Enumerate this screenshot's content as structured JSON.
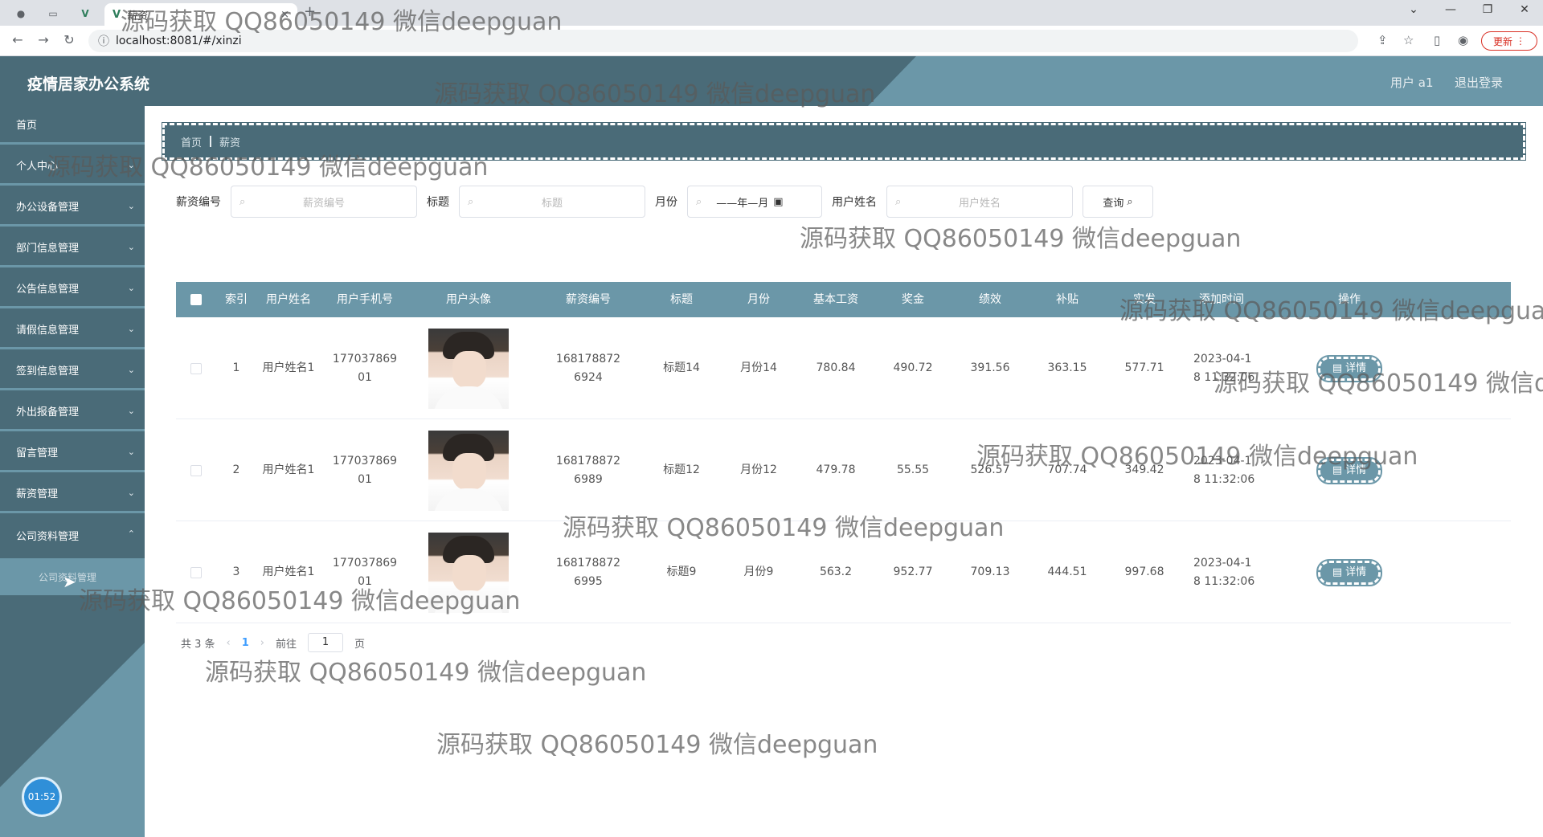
{
  "browser": {
    "tab_title": "薪资",
    "url": "localhost:8081/#/xinzi",
    "update_label": "更新"
  },
  "header": {
    "title": "疫情居家办公系统",
    "user": "用户 a1",
    "logout": "退出登录"
  },
  "sidebar": {
    "items": [
      {
        "label": "首页"
      },
      {
        "label": "个人中心"
      },
      {
        "label": "办公设备管理"
      },
      {
        "label": "部门信息管理"
      },
      {
        "label": "公告信息管理"
      },
      {
        "label": "请假信息管理"
      },
      {
        "label": "签到信息管理"
      },
      {
        "label": "外出报备管理"
      },
      {
        "label": "留言管理"
      },
      {
        "label": "薪资管理"
      },
      {
        "label": "公司资料管理"
      }
    ],
    "submenu_label": "公司资料管理",
    "clock": "01:52"
  },
  "breadcrumb": {
    "home": "首页",
    "current": "薪资"
  },
  "search": {
    "salary_no_label": "薪资编号",
    "salary_no_placeholder": "薪资编号",
    "title_label": "标题",
    "title_placeholder": "标题",
    "month_label": "月份",
    "month_value": "——年—月",
    "username_label": "用户姓名",
    "username_placeholder": "用户姓名",
    "query_label": "查询"
  },
  "table": {
    "headers": [
      "索引",
      "用户姓名",
      "用户手机号",
      "用户头像",
      "薪资编号",
      "标题",
      "月份",
      "基本工资",
      "奖金",
      "绩效",
      "补贴",
      "实发",
      "添加时间",
      "操作"
    ],
    "rows": [
      {
        "index": "1",
        "name": "用户姓名1",
        "phone_a": "177037869",
        "phone_b": "01",
        "salary_no_a": "168178872",
        "salary_no_b": "6924",
        "title": "标题14",
        "month": "月份14",
        "base": "780.84",
        "bonus": "490.72",
        "perf": "391.56",
        "allowance": "363.15",
        "net": "577.71",
        "time_a": "2023-04-1",
        "time_b": "8 11:32:06",
        "action": "详情"
      },
      {
        "index": "2",
        "name": "用户姓名1",
        "phone_a": "177037869",
        "phone_b": "01",
        "salary_no_a": "168178872",
        "salary_no_b": "6989",
        "title": "标题12",
        "month": "月份12",
        "base": "479.78",
        "bonus": "55.55",
        "perf": "526.57",
        "allowance": "707.74",
        "net": "349.42",
        "time_a": "2023-04-1",
        "time_b": "8 11:32:06",
        "action": "详情"
      },
      {
        "index": "3",
        "name": "用户姓名1",
        "phone_a": "177037869",
        "phone_b": "01",
        "salary_no_a": "168178872",
        "salary_no_b": "6995",
        "title": "标题9",
        "month": "月份9",
        "base": "563.2",
        "bonus": "952.77",
        "perf": "709.13",
        "allowance": "444.51",
        "net": "997.68",
        "time_a": "2023-04-1",
        "time_b": "8 11:32:06",
        "action": "详情"
      }
    ]
  },
  "pagination": {
    "total": "共 3 条",
    "current_page": "1",
    "goto_label": "前往",
    "goto_value": "1",
    "page_suffix": "页"
  },
  "watermark": "源码获取 QQ86050149 微信deepguan"
}
